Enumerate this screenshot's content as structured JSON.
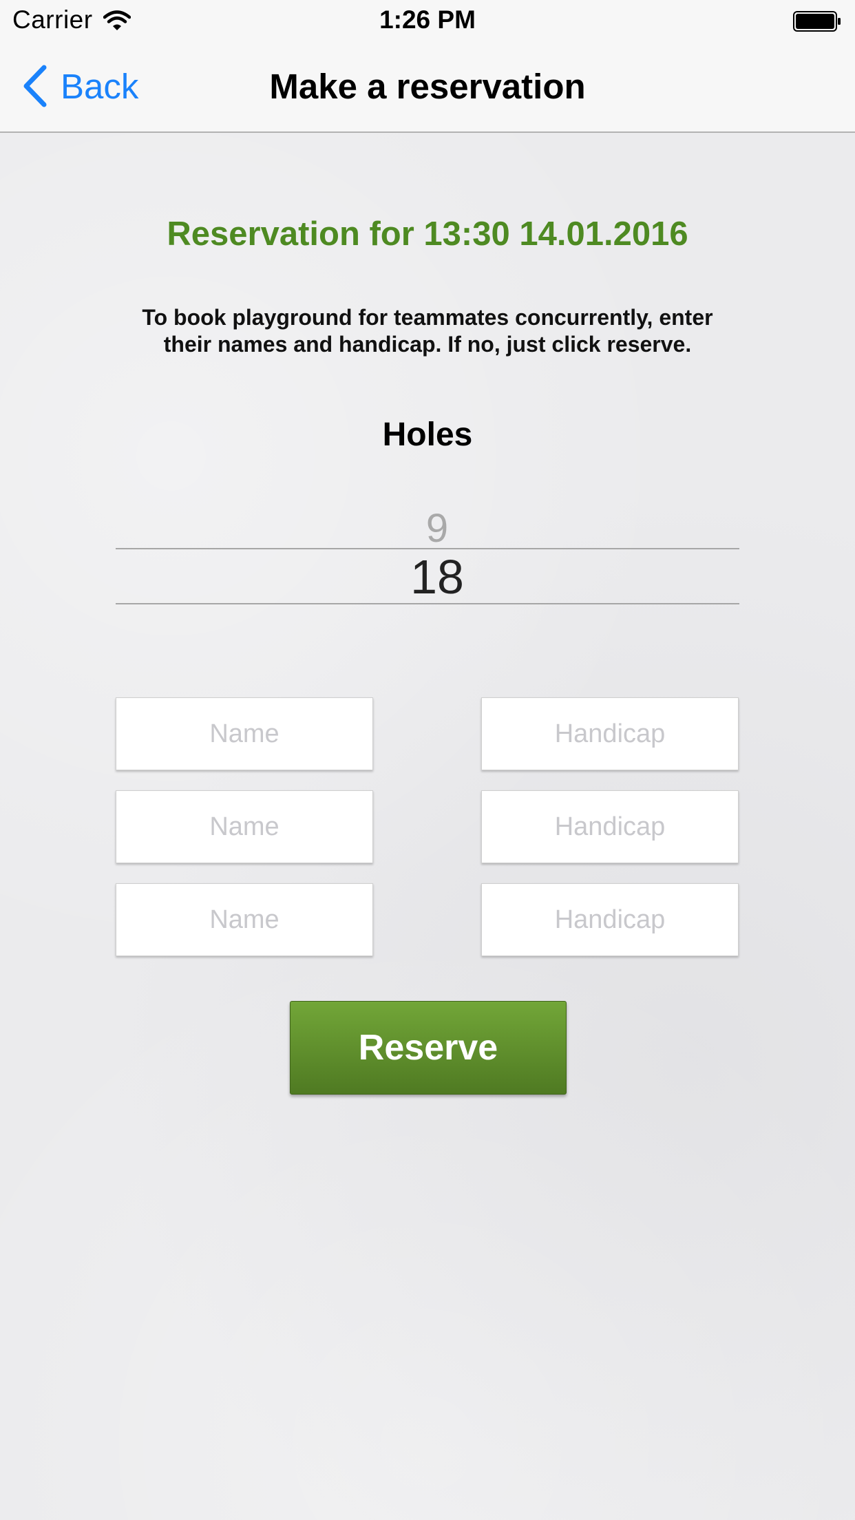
{
  "status_bar": {
    "carrier": "Carrier",
    "time": "1:26 PM",
    "wifi_icon": "wifi-icon",
    "battery_icon": "battery-icon"
  },
  "nav": {
    "back_label": "Back",
    "back_icon": "chevron-left-icon",
    "title": "Make a reservation",
    "accent_color": "#1a82fb"
  },
  "main": {
    "reservation_title": "Reservation for 13:30 14.01.2016",
    "title_color": "#4e8a22",
    "instructions": "To book playground for teammates concurrently, enter their names and handicap. If no, just click reserve.",
    "holes_label": "Holes",
    "holes_picker": {
      "options": [
        "9",
        "18"
      ],
      "selected": "18"
    },
    "teammates": [
      {
        "name_placeholder": "Name",
        "handicap_placeholder": "Handicap"
      },
      {
        "name_placeholder": "Name",
        "handicap_placeholder": "Handicap"
      },
      {
        "name_placeholder": "Name",
        "handicap_placeholder": "Handicap"
      }
    ],
    "reserve_label": "Reserve",
    "button_color": "#5f8f2c"
  }
}
